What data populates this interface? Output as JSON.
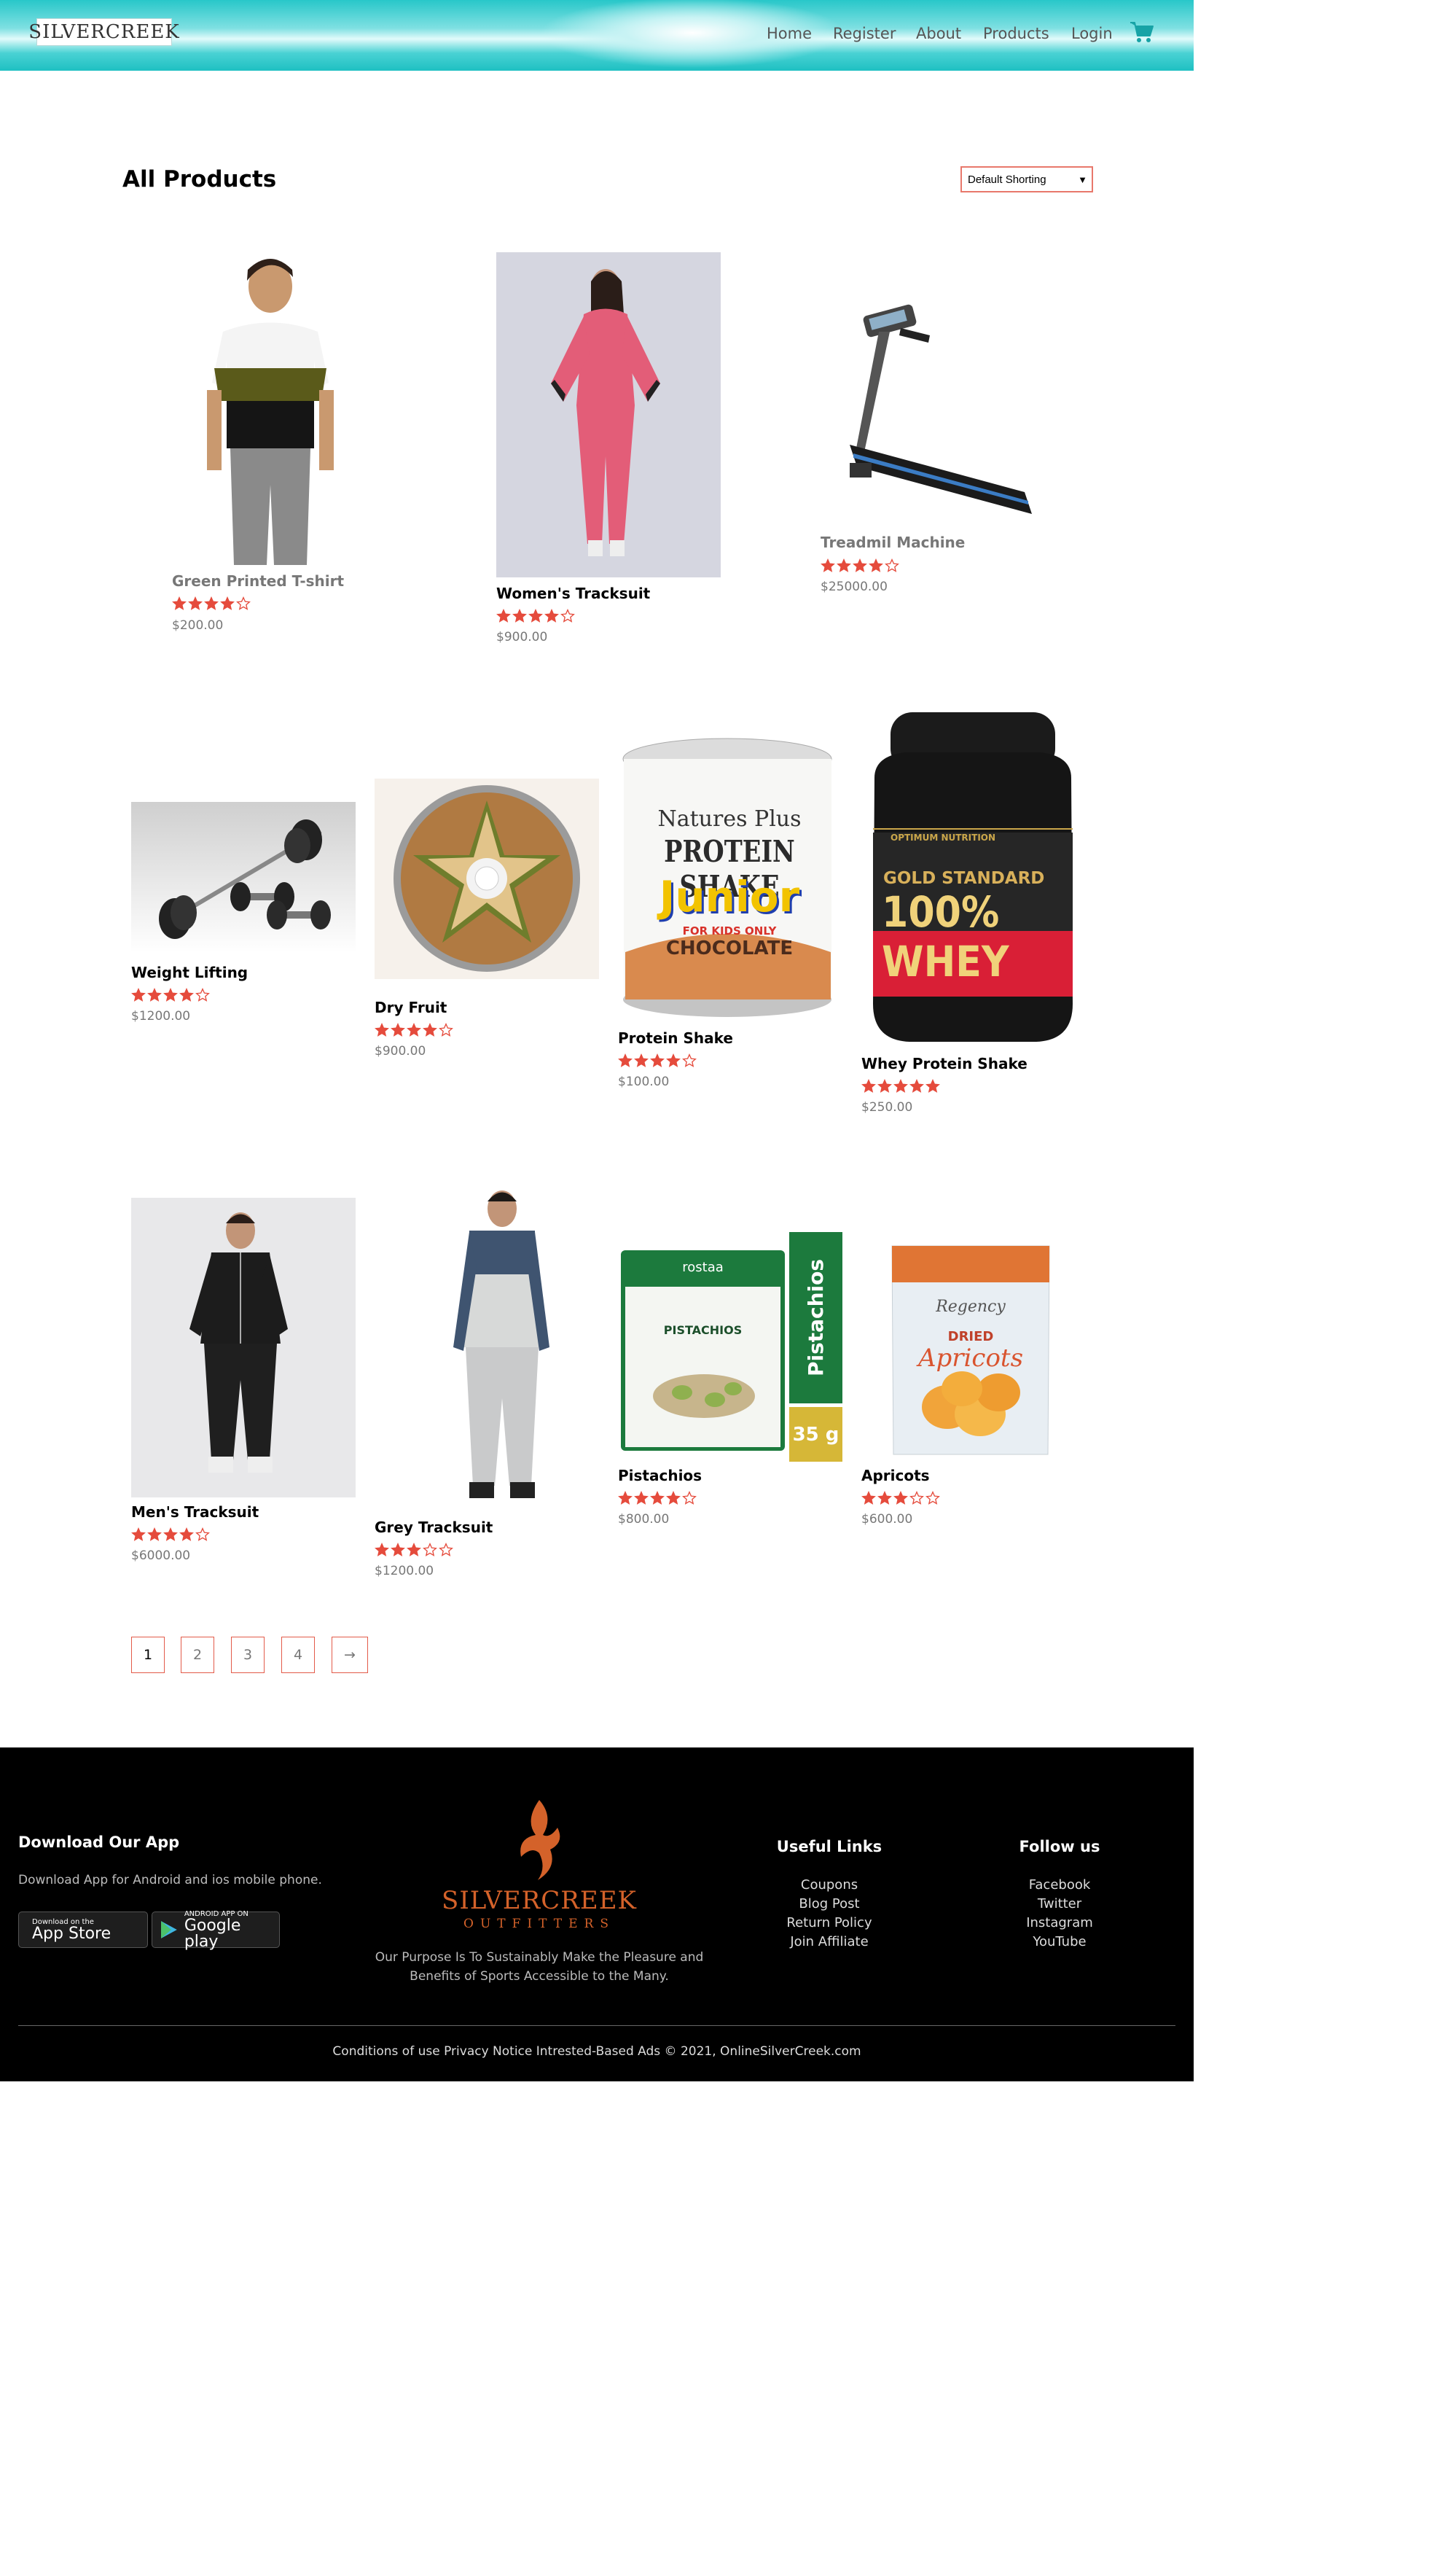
{
  "header": {
    "logo_text": "SILVERCREEK",
    "nav": [
      "Home",
      "Register",
      "About",
      "Products",
      "Login"
    ],
    "cart_icon": "cart-icon",
    "accent_color": "#17a3a6"
  },
  "main": {
    "title": "All Products",
    "sort_selected": "Default Shorting",
    "star_color": "#e54b3c",
    "products": [
      {
        "name": "Green Printed T-shirt",
        "rating": 4,
        "price": "$200.00"
      },
      {
        "name": "Women's Tracksuit",
        "rating": 4,
        "price": "$900.00"
      },
      {
        "name": "Treadmil Machine",
        "rating": 4,
        "price": "$25000.00"
      },
      {
        "name": "Weight Lifting",
        "rating": 4,
        "price": "$1200.00"
      },
      {
        "name": "Dry Fruit",
        "rating": 4,
        "price": "$900.00"
      },
      {
        "name": "Protein Shake",
        "rating": 4,
        "price": "$100.00"
      },
      {
        "name": "Whey Protein Shake",
        "rating": 5,
        "price": "$250.00"
      },
      {
        "name": "Men's Tracksuit",
        "rating": 4,
        "price": "$6000.00"
      },
      {
        "name": "Grey Tracksuit",
        "rating": 3,
        "price": "$1200.00"
      },
      {
        "name": "Pistachios",
        "rating": 4,
        "price": "$800.00"
      },
      {
        "name": "Apricots",
        "rating": 3,
        "price": "$600.00"
      }
    ],
    "product_image_text": {
      "protein_brand": "Natures Plus",
      "protein_line1": "PROTEIN SHAKE",
      "protein_line2": "Junior",
      "protein_sub1": "FOR KIDS ONLY",
      "protein_sub2": "CHOCOLATE",
      "whey_brand": "OPTIMUM NUTRITION",
      "whey_line1": "GOLD STANDARD",
      "whey_line2": "100% WHEY",
      "pist_brand": "rostaa",
      "pist_label": "PISTACHIOS",
      "pist_side": "Pistachios",
      "pist_weight": "35 g",
      "apricot_brand": "Regency",
      "apricot_label1": "DRIED",
      "apricot_label2": "Apricots"
    },
    "pagination": [
      "1",
      "2",
      "3",
      "4",
      "→"
    ],
    "current_page": "1"
  },
  "footer": {
    "app_title": "Download Our App",
    "app_text": "Download App for Android and ios mobile phone.",
    "appstore_small": "Download on the",
    "appstore_big": "App Store",
    "play_small": "ANDROID APP ON",
    "play_big": "Google play",
    "logo_main": "SILVERCREEK",
    "logo_sub": "OUTFITTERS",
    "purpose_line1": "Our Purpose Is To Sustainably Make the Pleasure and",
    "purpose_line2": "Benefits of Sports Accessible to the Many.",
    "useful_title": "Useful Links",
    "useful_links": [
      "Coupons",
      "Blog Post",
      "Return Policy",
      "Join Affiliate"
    ],
    "follow_title": "Follow us",
    "follow_links": [
      "Facebook",
      "Twitter",
      "Instagram",
      "YouTube"
    ],
    "copyright": "Conditions of use Privacy Notice Intrested-Based Ads © 2021, OnlineSilverCreek.com"
  }
}
